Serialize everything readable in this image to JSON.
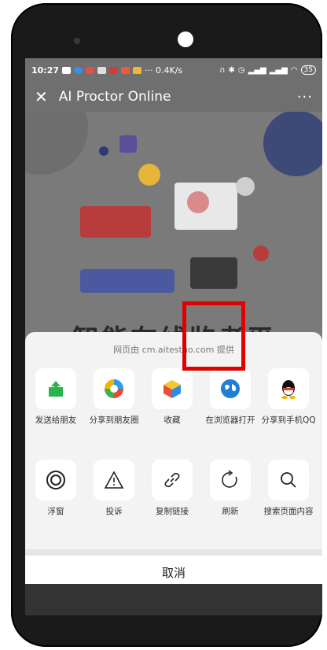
{
  "status": {
    "time": "10:27",
    "net_speed": "··· 0.4K/s",
    "battery": "35"
  },
  "appbar": {
    "title": "AI Proctor Online",
    "more": "···"
  },
  "page": {
    "headline": "智能在线监考平"
  },
  "sheet": {
    "provider": "网页由 cm.aitestgo.com 提供",
    "row1": [
      {
        "label": "发送给朋友",
        "icon": "send-to-friend-icon"
      },
      {
        "label": "分享到朋友圈",
        "icon": "moments-icon"
      },
      {
        "label": "收藏",
        "icon": "favorite-icon"
      },
      {
        "label": "在浏览器打开",
        "icon": "browser-icon"
      },
      {
        "label": "分享到手机QQ",
        "icon": "qq-icon"
      }
    ],
    "row2": [
      {
        "label": "浮窗",
        "icon": "float-window-icon"
      },
      {
        "label": "投诉",
        "icon": "complaint-icon"
      },
      {
        "label": "复制链接",
        "icon": "copy-link-icon"
      },
      {
        "label": "刷新",
        "icon": "refresh-icon"
      },
      {
        "label": "搜索页面内容",
        "icon": "search-icon"
      }
    ],
    "cancel": "取消"
  }
}
